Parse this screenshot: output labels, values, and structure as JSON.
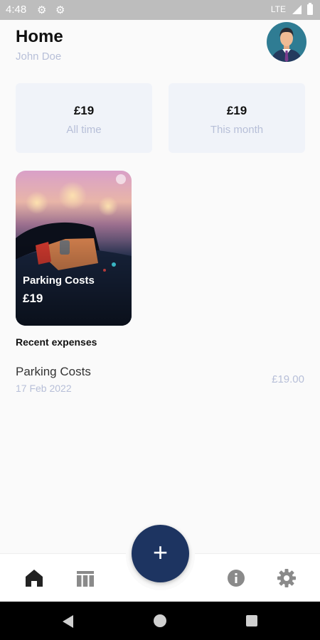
{
  "status_bar": {
    "time": "4:48",
    "network": "LTE"
  },
  "header": {
    "title": "Home",
    "user_name": "John Doe"
  },
  "stats": [
    {
      "amount": "£19",
      "label": "All time"
    },
    {
      "amount": "£19",
      "label": "This month"
    }
  ],
  "categories": [
    {
      "name": "Parking Costs",
      "amount": "£19"
    }
  ],
  "recent": {
    "title": "Recent expenses",
    "items": [
      {
        "name": "Parking Costs",
        "date": "17 Feb 2022",
        "amount": "£19.00"
      }
    ]
  },
  "fab": {
    "label": "+"
  },
  "nav": [
    "home-icon",
    "table-icon",
    "info-icon",
    "settings-icon"
  ],
  "colors": {
    "accent": "#1d3461",
    "muted": "#b7bfd8",
    "card_bg": "#f0f3f9"
  }
}
